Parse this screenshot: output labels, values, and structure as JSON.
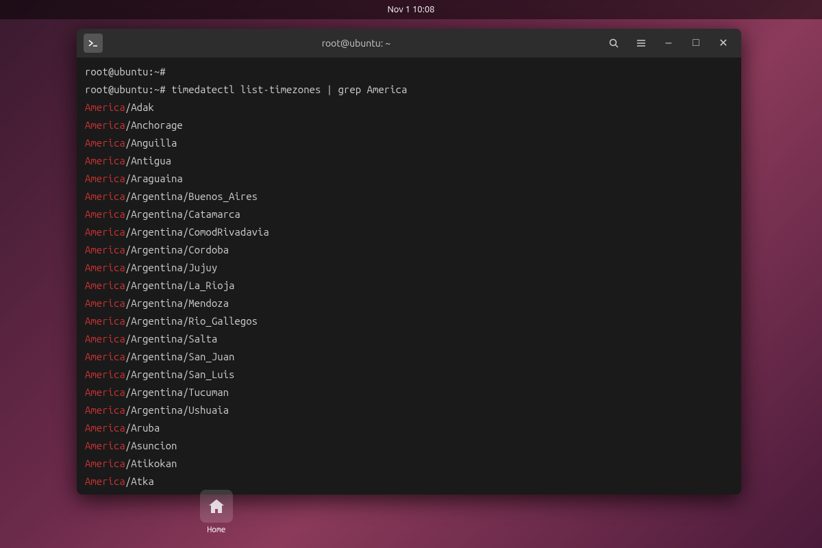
{
  "taskbar": {
    "datetime": "Nov 1  10:08"
  },
  "terminal": {
    "title": "root@ubuntu: ~",
    "icon_label": "⊞",
    "search_btn": "🔍",
    "menu_btn": "☰",
    "minimize_btn": "–",
    "maximize_btn": "□",
    "close_btn": "✕",
    "lines": [
      {
        "type": "prompt",
        "text": "root@ubuntu:~#"
      },
      {
        "type": "command",
        "prompt": "root@ubuntu:~#",
        "cmd": " timedatectl list-timezones | grep America"
      },
      {
        "type": "tz",
        "red": "America",
        "white": "/Adak"
      },
      {
        "type": "tz",
        "red": "America",
        "white": "/Anchorage"
      },
      {
        "type": "tz",
        "red": "America",
        "white": "/Anguilla"
      },
      {
        "type": "tz",
        "red": "America",
        "white": "/Antigua"
      },
      {
        "type": "tz",
        "red": "America",
        "white": "/Araguaina"
      },
      {
        "type": "tz",
        "red": "America",
        "white": "/Argentina/Buenos_Aires"
      },
      {
        "type": "tz",
        "red": "America",
        "white": "/Argentina/Catamarca"
      },
      {
        "type": "tz",
        "red": "America",
        "white": "/Argentina/ComodRivadavia"
      },
      {
        "type": "tz",
        "red": "America",
        "white": "/Argentina/Cordoba"
      },
      {
        "type": "tz",
        "red": "America",
        "white": "/Argentina/Jujuy"
      },
      {
        "type": "tz",
        "red": "America",
        "white": "/Argentina/La_Rioja"
      },
      {
        "type": "tz",
        "red": "America",
        "white": "/Argentina/Mendoza"
      },
      {
        "type": "tz",
        "red": "America",
        "white": "/Argentina/Rio_Gallegos"
      },
      {
        "type": "tz",
        "red": "America",
        "white": "/Argentina/Salta"
      },
      {
        "type": "tz",
        "red": "America",
        "white": "/Argentina/San_Juan"
      },
      {
        "type": "tz",
        "red": "America",
        "white": "/Argentina/San_Luis"
      },
      {
        "type": "tz",
        "red": "America",
        "white": "/Argentina/Tucuman"
      },
      {
        "type": "tz",
        "red": "America",
        "white": "/Argentina/Ushuaia"
      },
      {
        "type": "tz",
        "red": "America",
        "white": "/Aruba"
      },
      {
        "type": "tz",
        "red": "America",
        "white": "/Asuncion"
      },
      {
        "type": "tz",
        "red": "America",
        "white": "/Atikokan"
      },
      {
        "type": "tz",
        "red": "America",
        "white": "/Atka"
      }
    ]
  },
  "desktop": {
    "home_label": "Home"
  }
}
